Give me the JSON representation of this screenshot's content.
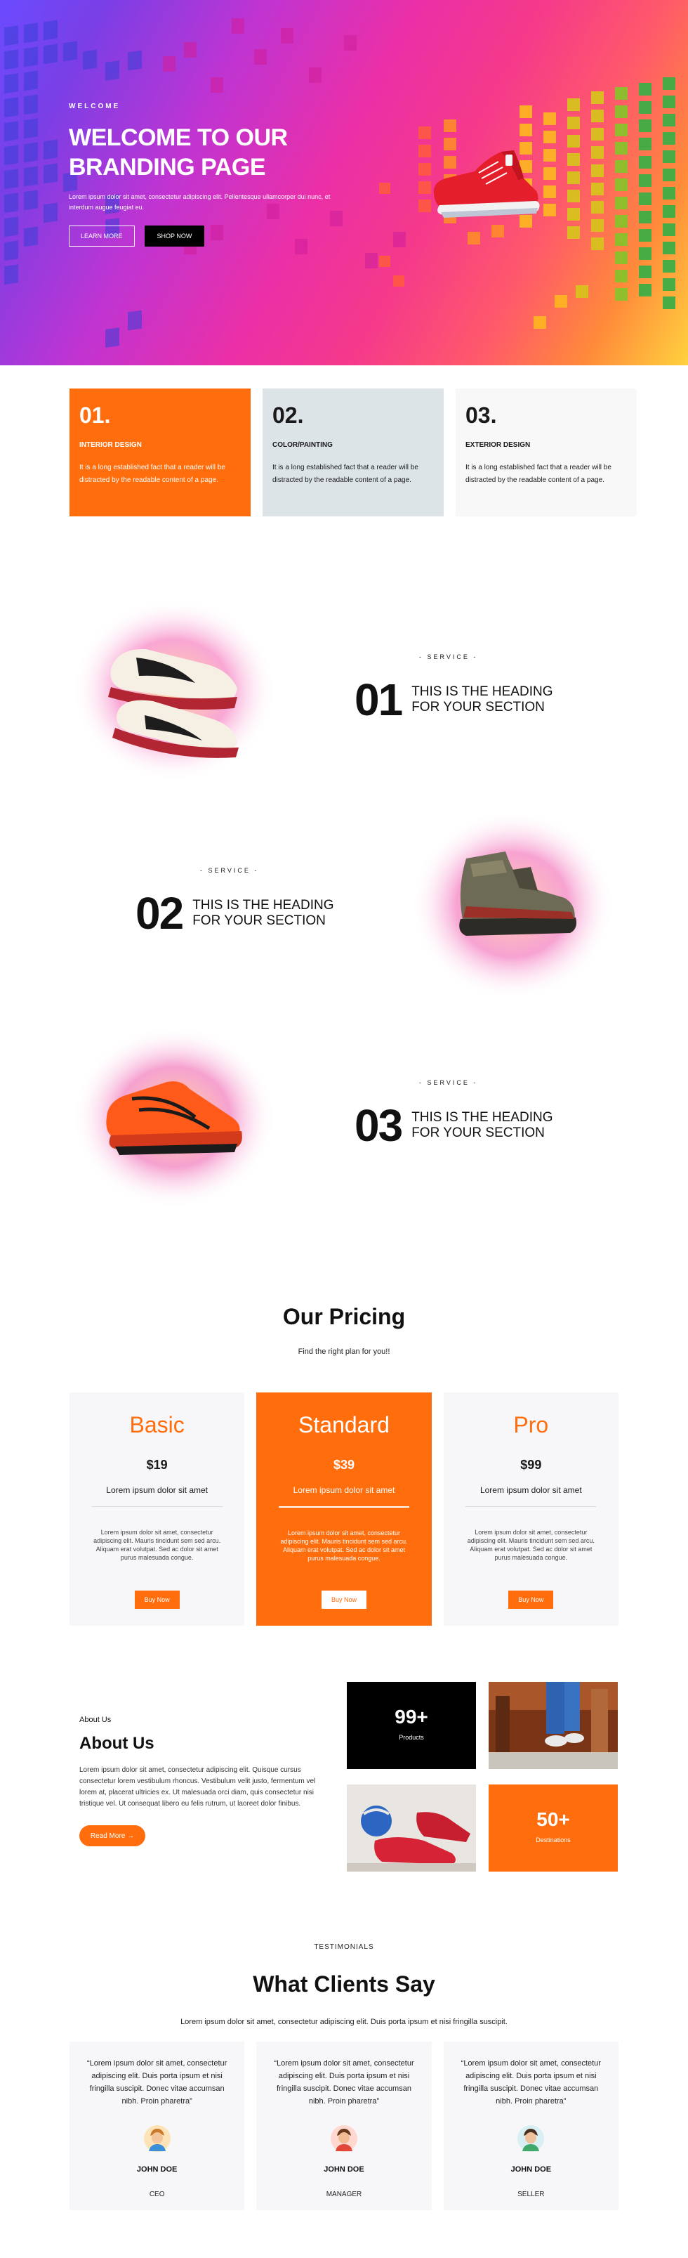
{
  "hero": {
    "kicker": "WELCOME",
    "title_line1": "WELCOME TO OUR",
    "title_line2": "BRANDING PAGE",
    "description": "Lorem ipsum dolor sit amet, consectetur adipiscing elit. Pellentesque ullamcorper dui nunc, et interdum augue feugiat eu.",
    "learn_more": "LEARN MORE",
    "shop_now": "SHOP NOW"
  },
  "features": [
    {
      "number": "01.",
      "title": "INTERIOR DESIGN",
      "text": "It is a long established fact that a reader will be distracted by the readable content of a page."
    },
    {
      "number": "02.",
      "title": "COLOR/PAINTING",
      "text": "It is a long established fact that a reader will be distracted by the readable content of a page."
    },
    {
      "number": "03.",
      "title": "EXTERIOR DESIGN",
      "text": "It is a long established fact that a reader will be distracted by the readable content of a page."
    }
  ],
  "services": [
    {
      "kicker": "- SERVICE -",
      "number": "01",
      "heading_line1": "THIS IS THE HEADING",
      "heading_line2": "FOR YOUR SECTION",
      "image": "sneaker-icon"
    },
    {
      "kicker": "- SERVICE -",
      "number": "02",
      "heading_line1": "THIS IS THE HEADING",
      "heading_line2": "FOR YOUR SECTION",
      "image": "boot-icon"
    },
    {
      "kicker": "- SERVICE -",
      "number": "03",
      "heading_line1": "THIS IS THE HEADING",
      "heading_line2": "FOR YOUR SECTION",
      "image": "running-shoe-icon"
    }
  ],
  "pricing": {
    "title": "Our Pricing",
    "subtitle": "Find the right plan for you!!",
    "plans": [
      {
        "name": "Basic",
        "price": "$19",
        "tagline": "Lorem ipsum dolor sit amet",
        "description": "Lorem ipsum dolor sit amet, consectetur adipiscing elit. Mauris tincidunt sem sed arcu. Aliquam erat volutpat. Sed ac dolor sit amet purus malesuada congue.",
        "button": "Buy Now"
      },
      {
        "name": "Standard",
        "price": "$39",
        "tagline": "Lorem ipsum dolor sit amet",
        "description": "Lorem ipsum dolor sit amet, consectetur adipiscing elit. Mauris tincidunt sem sed arcu. Aliquam erat volutpat. Sed ac dolor sit amet purus malesuada congue.",
        "button": "Buy Now"
      },
      {
        "name": "Pro",
        "price": "$99",
        "tagline": "Lorem ipsum dolor sit amet",
        "description": "Lorem ipsum dolor sit amet, consectetur adipiscing elit. Mauris tincidunt sem sed arcu. Aliquam erat volutpat. Sed ac dolor sit amet purus malesuada congue.",
        "button": "Buy Now"
      }
    ]
  },
  "about": {
    "kicker": "About Us",
    "title": "About Us",
    "description": "Lorem ipsum dolor sit amet, consectetur adipiscing elit. Quisque cursus consectetur lorem vestibulum rhoncus. Vestibulum velit justo, fermentum vel lorem at, placerat ultricies ex. Ut malesuada orci diam, quis consectetur nisi tristique vel. Ut consequat libero eu felis rutrum, ut laoreet dolor finibus.",
    "button": "Read More →",
    "stat1_number": "99+",
    "stat1_label": "Products",
    "stat2_number": "50+",
    "stat2_label": "Destinations"
  },
  "testimonials": {
    "kicker": "TESTIMONIALS",
    "title": "What Clients Say",
    "subtitle": "Lorem ipsum dolor sit amet, consectetur adipiscing elit. Duis porta ipsum et nisi fringilla suscipit.",
    "reviews": [
      {
        "quote": "“Lorem ipsum dolor sit amet, consectetur adipiscing elit. Duis porta ipsum et nisi fringilla suscipit. Donec vitae accumsan nibh. Proin pharetra”",
        "name": "JOHN DOE",
        "role": "CEO"
      },
      {
        "quote": "“Lorem ipsum dolor sit amet, consectetur adipiscing elit. Duis porta ipsum et nisi fringilla suscipit. Donec vitae accumsan nibh. Proin pharetra”",
        "name": "JOHN DOE",
        "role": "MANAGER"
      },
      {
        "quote": "“Lorem ipsum dolor sit amet, consectetur adipiscing elit. Duis porta ipsum et nisi fringilla suscipit. Donec vitae accumsan nibh. Proin pharetra”",
        "name": "JOHN DOE",
        "role": "SELLER"
      }
    ]
  },
  "colors": {
    "accent": "#ff6d0c",
    "dark": "#000000",
    "light_card": "#f7f7fa",
    "grey_card": "#dde4e8"
  }
}
